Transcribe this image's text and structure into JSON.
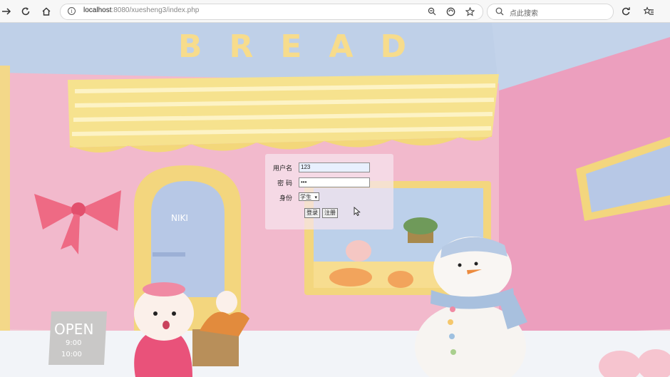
{
  "browser": {
    "url_host": "localhost",
    "url_rest": ":8080/xuesheng3/index.php",
    "search_placeholder": "点此搜索"
  },
  "scene": {
    "sign_text": "BREAD",
    "door_text": "NIKI",
    "board_title": "OPEN",
    "board_time1": "9:00",
    "board_time2": "10:00"
  },
  "login": {
    "username_label": "用户名",
    "username_value": "123",
    "password_label": "密 码",
    "password_value": "•••",
    "role_label": "身份",
    "role_selected": "学生",
    "login_button": "登录",
    "register_button": "注册"
  }
}
